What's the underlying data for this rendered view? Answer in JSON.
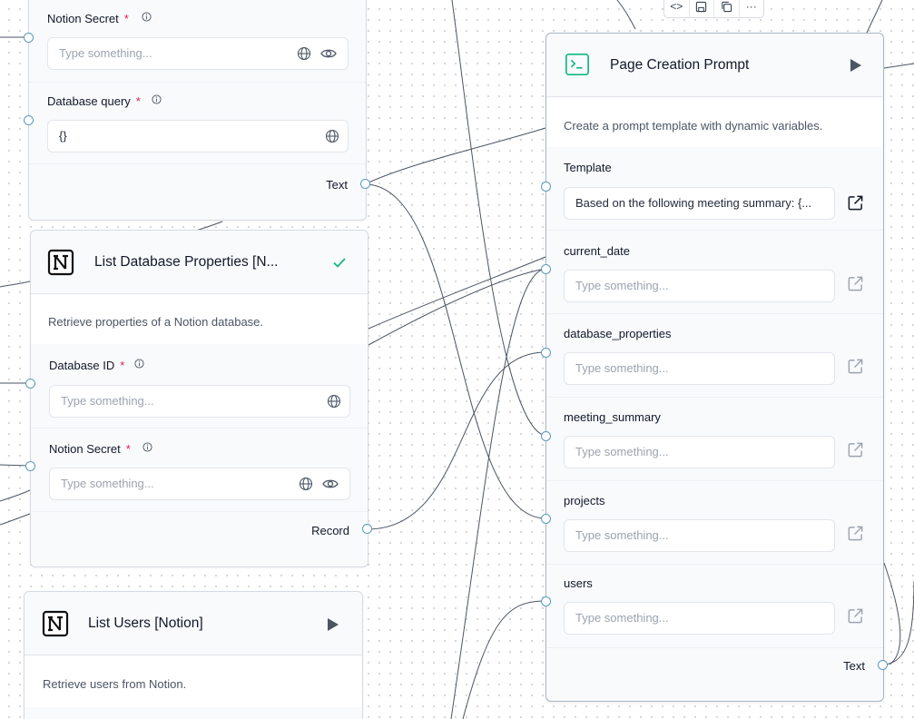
{
  "notion_query_node": {
    "notion_secret_label": "Notion Secret",
    "notion_secret_placeholder": "Type something...",
    "database_query_label": "Database query",
    "database_query_value": "{}",
    "output_label": "Text"
  },
  "list_db_props_node": {
    "title": "List Database Properties [N...",
    "description": "Retrieve properties of a Notion database.",
    "database_id_label": "Database ID",
    "database_id_placeholder": "Type something...",
    "notion_secret_label": "Notion Secret",
    "notion_secret_placeholder": "Type something...",
    "output_label": "Record",
    "status_icon": "check-icon"
  },
  "list_users_node": {
    "title": "List Users [Notion]",
    "description": "Retrieve users from Notion."
  },
  "prompt_node": {
    "title": "Page Creation Prompt",
    "description": "Create a prompt template with dynamic variables.",
    "template_label": "Template",
    "template_value": "Based on the following meeting summary: {...",
    "current_date_label": "current_date",
    "database_properties_label": "database_properties",
    "meeting_summary_label": "meeting_summary",
    "projects_label": "projects",
    "users_label": "users",
    "placeholder": "Type something...",
    "output_label": "Text"
  },
  "toolbar": {
    "code_icon": "<>",
    "more_icon": "···"
  },
  "colors": {
    "accent_green": "#10b981",
    "handle_blue": "#5b9bb8",
    "required_red": "#e11d48"
  }
}
